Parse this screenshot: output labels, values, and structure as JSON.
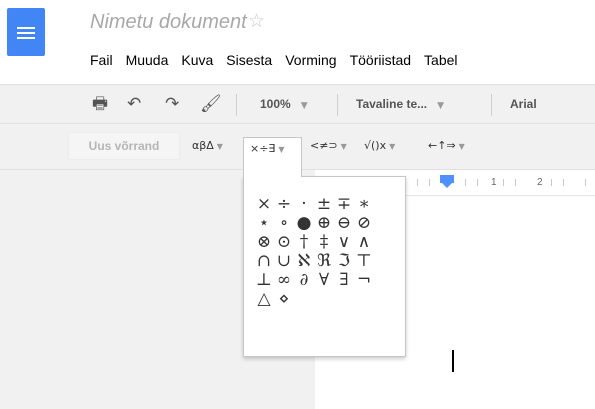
{
  "document": {
    "title": "Nimetu dokument",
    "star_icon": "☆"
  },
  "menu": [
    "Fail",
    "Muuda",
    "Kuva",
    "Sisesta",
    "Vorming",
    "Tööriistad",
    "Tabel"
  ],
  "toolbar": {
    "print_icon": "🖶",
    "undo_icon": "↶",
    "redo_icon": "↷",
    "paint_icon": "🖌",
    "zoom": "100%",
    "style": "Tavaline te...",
    "font": "Arial",
    "dropdown_arrow": "▼"
  },
  "equation_toolbar": {
    "new_equation": "Uus võrrand",
    "greek": "αβΔ",
    "operators": "×÷∃",
    "relations": "<≠⊃",
    "math": "√()x",
    "arrows": "←↑⇒",
    "dropdown_arrow": "▼"
  },
  "ruler": {
    "labels": [
      "1",
      "2"
    ]
  },
  "symbols": [
    "×",
    "÷",
    "·",
    "±",
    "∓",
    "∗",
    "⋆",
    "∘",
    "●",
    "⊕",
    "⊖",
    "⊘",
    "⊗",
    "⊙",
    "†",
    "‡",
    "∨",
    "∧",
    "∩",
    "∪",
    "ℵ",
    "ℜ",
    "ℑ",
    "⊤",
    "⊥",
    "∞",
    "∂",
    "∀",
    "∃",
    "¬",
    "△",
    "⋄"
  ],
  "colors": {
    "accent": "#4285f4",
    "toolbar_bg": "#f1f1f1",
    "ruler_marker": "#4d90fe"
  }
}
